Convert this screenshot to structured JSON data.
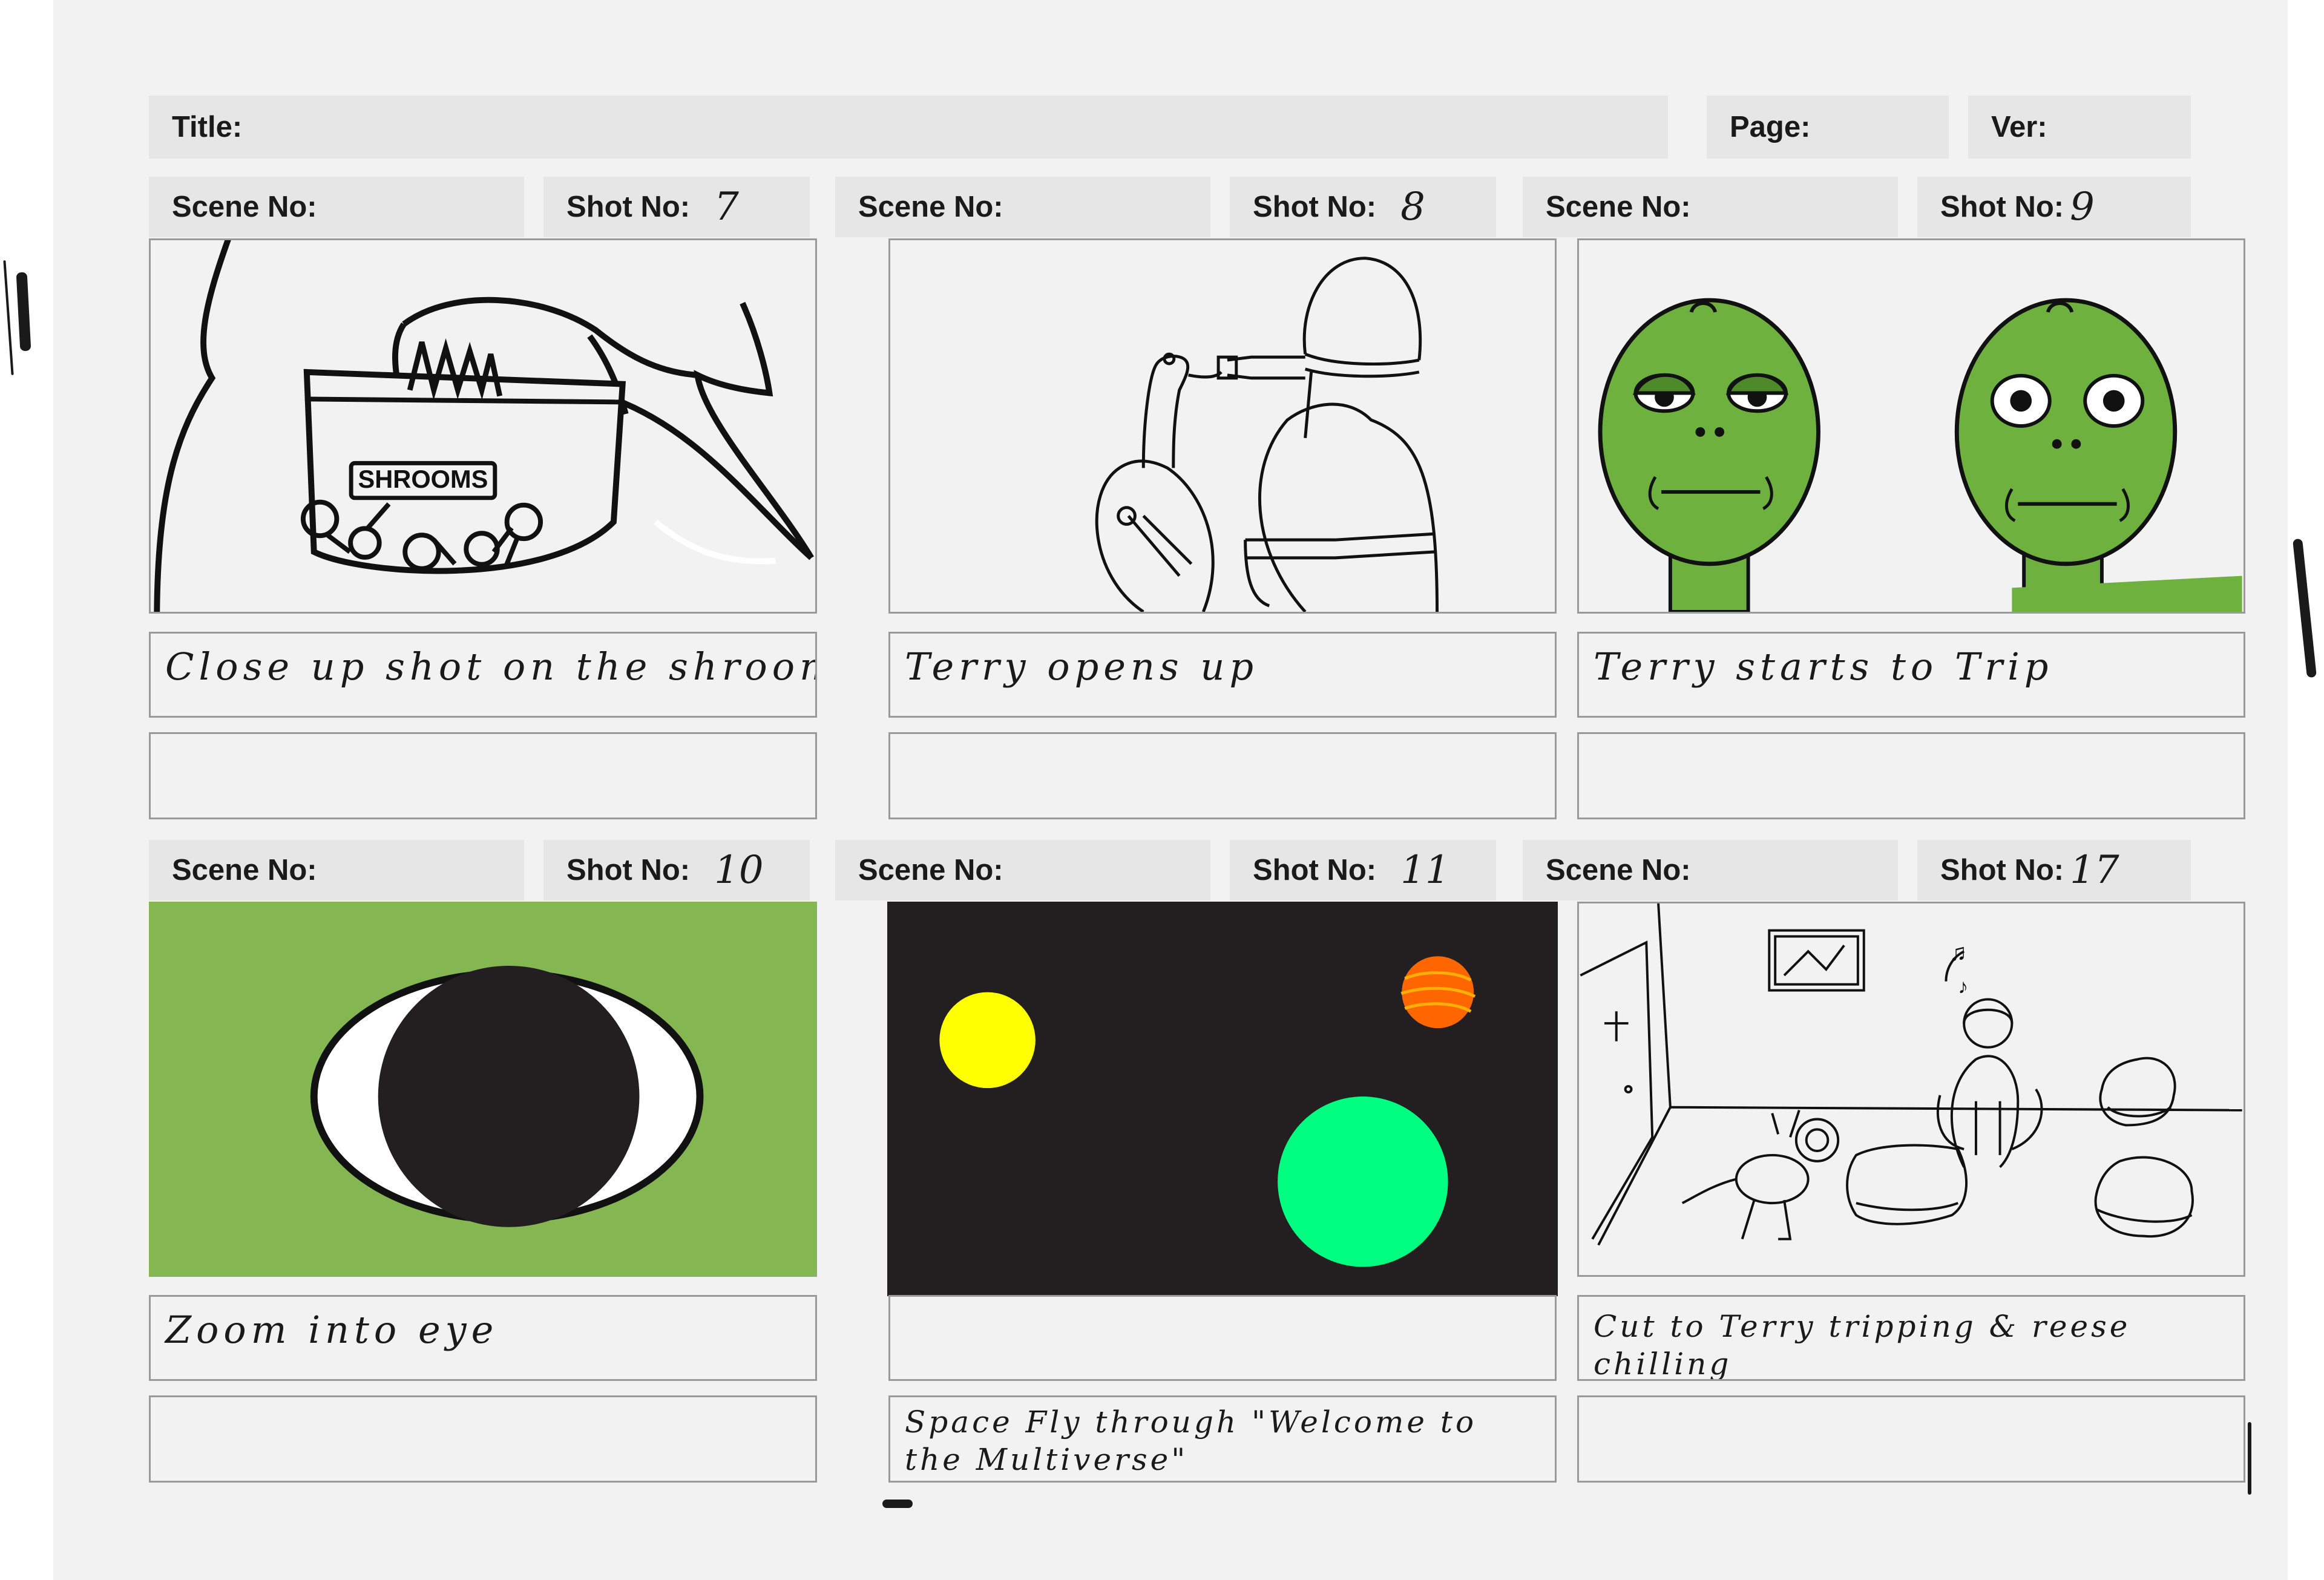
{
  "header": {
    "title_label": "Title:",
    "page_label": "Page:",
    "ver_label": "Ver:"
  },
  "labels": {
    "scene": "Scene No:",
    "shot": "Shot No:"
  },
  "panels": [
    {
      "shot_number": "7",
      "note": "Close up shot on the shrooms",
      "note2": "",
      "jar_label": "SHROOMS"
    },
    {
      "shot_number": "8",
      "note": "Terry opens up",
      "note2": ""
    },
    {
      "shot_number": "9",
      "note": "Terry starts to Trip",
      "note2": ""
    },
    {
      "shot_number": "10",
      "note": "Zoom into eye",
      "note2": ""
    },
    {
      "shot_number": "11",
      "note": "",
      "note2": "Space Fly through \"Welcome to the Multiverse\""
    },
    {
      "shot_number": "17",
      "note": "Cut to Terry tripping & reese chilling",
      "note2": ""
    }
  ],
  "colors": {
    "sheet": "#f2f2f2",
    "header_fill": "#e6e6e6",
    "alien_green": "#6fb13e",
    "eye_bg_green": "#84b751",
    "space_black": "#231f20",
    "sun_yellow": "#ffff00",
    "planet_orange": "#ff6600",
    "planet_green": "#00ff80"
  }
}
